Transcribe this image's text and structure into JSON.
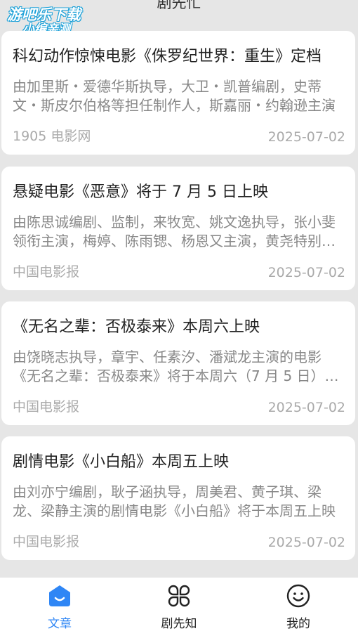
{
  "header": {
    "title": "剧先忙"
  },
  "watermark": {
    "line1": "游吧乐下载",
    "line2": "小编亲测"
  },
  "articles": [
    {
      "title": "科幻动作惊悚电影《侏罗纪世界：重生》定档",
      "summary": "由加里斯・爱德华斯执导，大卫・凯普编剧，史蒂文・斯皮尔伯格等担任制作人，斯嘉丽・约翰逊主演",
      "source": "1905 电影网",
      "date": "2025-07-02"
    },
    {
      "title": "悬疑电影《恶意》将于 7 月 5 日上映",
      "summary": "由陈思诚编剧、监制，来牧宽、姚文逸执导，张小斐领衔主演，梅婷、陈雨锶、杨恩又主演，黄尧特别出演",
      "source": "中国电影报",
      "date": "2025-07-02"
    },
    {
      "title": "《无名之辈：否极泰来》本周六上映",
      "summary": "由饶晓志执导，章宇、任素汐、潘斌龙主演的电影《无名之辈：否极泰来》将于本周六（7 月 5 日）上映",
      "source": "中国电影报",
      "date": "2025-07-02"
    },
    {
      "title": "剧情电影《小白船》本周五上映",
      "summary": "由刘亦宁编剧，耿子涵执导，周美君、黄子琪、梁龙、梁静主演的剧情电影《小白船》将于本周五上映",
      "source": "中国电影报",
      "date": "2025-07-02"
    }
  ],
  "tabbar": {
    "tabs": [
      {
        "label": "文章",
        "icon": "home-icon",
        "active": true
      },
      {
        "label": "剧先知",
        "icon": "grid-icon",
        "active": false
      },
      {
        "label": "我的",
        "icon": "smiley-icon",
        "active": false
      }
    ],
    "accent": "#2f86f5"
  }
}
